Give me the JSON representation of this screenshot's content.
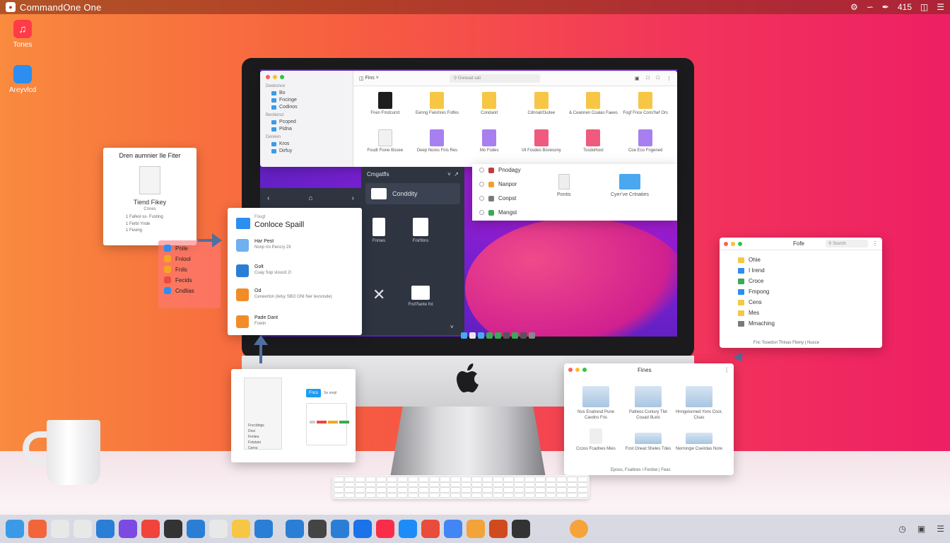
{
  "menubar": {
    "app_name": "CommandOne One",
    "clock": "415"
  },
  "desktop_icons": [
    {
      "label": "Tones",
      "color": "#ff3b48"
    },
    {
      "label": "Areyvlcd",
      "color": "#2b8ef0"
    }
  ],
  "finder_top": {
    "toolbar_label": "Fins",
    "search_placeholder": "Gonead sali",
    "sidebar": [
      {
        "section": "Deebonce",
        "items": [
          "Bo",
          "Fncinge",
          "Codinos"
        ]
      },
      {
        "section": "Berdeinst",
        "items": [
          "Pcoped",
          "Pidna"
        ]
      },
      {
        "section": "Dereien",
        "items": [
          "Kros",
          "Dirfuy"
        ]
      }
    ],
    "files": [
      {
        "name": "Fnen Fmdcurrd",
        "color": "#1e1e1e"
      },
      {
        "name": "Eenng Fwishres Folfes",
        "color": "#f6c644"
      },
      {
        "name": "Condanit",
        "color": "#f6c644"
      },
      {
        "name": "Cdnnat/Ouitee",
        "color": "#f6c644"
      },
      {
        "name": "& Ceannen Coalas Faees",
        "color": "#f6c644"
      },
      {
        "name": "Fogf Fnce Cons'hef Ors",
        "color": "#f6c644"
      },
      {
        "name": "Foudt Fione Bosee",
        "color": "#f1f1f1"
      },
      {
        "name": "Deep Nores Fnis Res",
        "color": "#a77ff0"
      },
      {
        "name": "Mo Fodes",
        "color": "#a77ff0"
      },
      {
        "name": "Vil Fosdes Bovesony",
        "color": "#f05a7e"
      },
      {
        "name": "Tosdolhost",
        "color": "#f05a7e"
      },
      {
        "name": "Coe Eco Fngened",
        "color": "#a77ff0"
      }
    ]
  },
  "dark_panel": {
    "header": "Cmgatfls",
    "selected": "Conddity",
    "items": [
      "Fnmes",
      "Fnirfitins",
      "Fnd?lante fnt"
    ],
    "bar_icon": "home-icon"
  },
  "list_win": {
    "rows": [
      {
        "label": "Pnodagy",
        "color": "#c03c3c"
      },
      {
        "label": "Nanpor",
        "color": "#f0a030"
      },
      {
        "label": "Conpst",
        "color": "#7a7a7a"
      },
      {
        "label": "Mangst",
        "color": "#3aaa55"
      }
    ],
    "files": [
      "Pontis",
      "Cyer’ve Crtnaties"
    ]
  },
  "conflict": {
    "small": "Fougt",
    "title": "Conloce Spaill",
    "items": [
      {
        "t1": "Har Pest",
        "t2": "Nonp tro Pencry 2II",
        "color": "#6fb0f0"
      },
      {
        "t1": "Golt",
        "t2": "Cuay Sop sloucd 2I",
        "color": "#2a7ed6"
      },
      {
        "t1": "Od",
        "t2": "Ceneerton (Ielsy SBO ONI Ner Ievsnsde)",
        "color": "#f28c28"
      },
      {
        "t1": "Pade Dant",
        "t2": "Fowtn",
        "color": "#f28c28"
      }
    ]
  },
  "filter_card": {
    "title": "Dren aumnier Ile Fiter",
    "sub": "Tiend Fikey",
    "sub2": "Cnnes",
    "lines": [
      "1 Fafesl·ss· Fusting",
      "1 Ferbi Ynde",
      "1 Fesing"
    ]
  },
  "red_list": [
    {
      "label": "Pnile",
      "color": "#2b8ef0"
    },
    {
      "label": "Fnlool",
      "color": "#f5a623"
    },
    {
      "label": "Fnils",
      "color": "#f5a623"
    },
    {
      "label": "Fecids",
      "color": "#e94c3d"
    },
    {
      "label": "Cndlias",
      "color": "#2b8ef0"
    }
  ],
  "preview_win": {
    "list": [
      "Fnccldngs",
      "Dosi",
      "Fenlea",
      "Fotstaro",
      "Cerns"
    ],
    "tag": "Fncs",
    "tag2": "Se ompl"
  },
  "right_win1": {
    "title": "Fofe",
    "search_placeholder": "Sosrch",
    "rows": [
      {
        "label": "Ohie",
        "color": "#f5c842"
      },
      {
        "label": "I Irend",
        "color": "#2b8ef0"
      },
      {
        "label": "Croce",
        "color": "#3aaa55"
      },
      {
        "label": "Fmpong",
        "color": "#2b8ef0"
      },
      {
        "label": "Cens",
        "color": "#f5c842"
      },
      {
        "label": "Mes",
        "color": "#f5c842"
      },
      {
        "label": "Mmaching",
        "color": "#7a7a7a"
      }
    ],
    "footer": "Fnc Tosedsn Thinas Fileny | Nucce"
  },
  "right_win2": {
    "title": "Fines",
    "cells": [
      "Nus Enatresd Pune Cavdns Fris",
      "Patteos Conisry Tlet Couad 9Lels",
      "Hnngeisnned Yons Coor, Cisas",
      "Ccoss Fcadnes Mies",
      "Fost Oneat Sheles Tdes",
      "Nerrongw Cseirdas Nore"
    ],
    "footer": "Eposs, Fsatines I Ferdse | Feac"
  },
  "dock_colors": [
    "#3a9ae8",
    "#f2653a",
    "#e8e8e8",
    "#e8e8e8",
    "#2a7ed6",
    "#7b4ae2",
    "#f0443c",
    "#333333",
    "#2a7ed6",
    "#e8e8e8",
    "#f6c644",
    "#2a7ed6",
    "#2a7ed6",
    "#444444",
    "#2a7ed6",
    "#1a73e8",
    "#fa2d48",
    "#1d8cf8",
    "#e94c3d",
    "#4285f4",
    "#f2a33a",
    "#d04a20",
    "#333333",
    "#f6a33a"
  ]
}
